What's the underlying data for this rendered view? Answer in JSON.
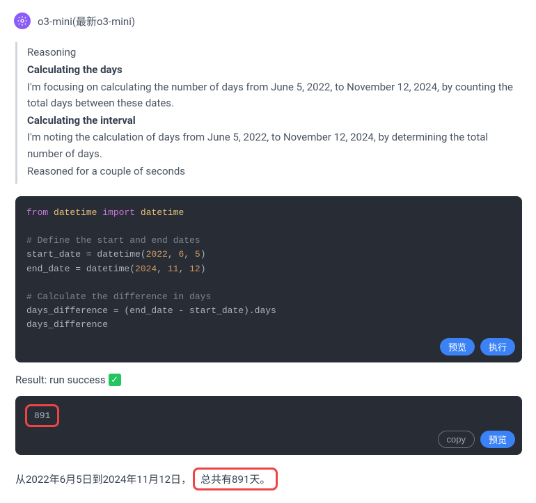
{
  "header": {
    "model_name": "o3-mini(最新o3-mini)"
  },
  "reasoning": {
    "title": "Reasoning",
    "heading1": "Calculating the days",
    "text1": "I'm focusing on calculating the number of days from June 5, 2022, to November 12, 2024, by counting the total days between these dates.",
    "heading2": "Calculating the interval",
    "text2": "I'm noting the calculation of days from June 5, 2022, to November 12, 2024, by determining the total number of days.",
    "footer": "Reasoned for a couple of seconds"
  },
  "code": {
    "l1_kw1": "from",
    "l1_mod1": "datetime",
    "l1_kw2": "import",
    "l1_mod2": "datetime",
    "c1": "# Define the start and end dates",
    "l3_var": "start_date = datetime(",
    "l3_y": "2022",
    "l3_m": "6",
    "l3_d": "5",
    "l3_end": ")",
    "l4_var": "end_date = datetime(",
    "l4_y": "2024",
    "l4_m": "11",
    "l4_d": "12",
    "l4_end": ")",
    "c2": "# Calculate the difference in days",
    "l6": "days_difference = (end_date - start_date).days",
    "l7": "days_difference",
    "actions": {
      "preview": "预览",
      "run": "执行"
    }
  },
  "result": {
    "label": "Result: run success"
  },
  "output": {
    "value": "891",
    "actions": {
      "copy": "copy",
      "preview": "预览"
    }
  },
  "summary": {
    "prefix": "从2022年6月5日到2024年11月12日，",
    "highlight": "总共有891天。"
  }
}
